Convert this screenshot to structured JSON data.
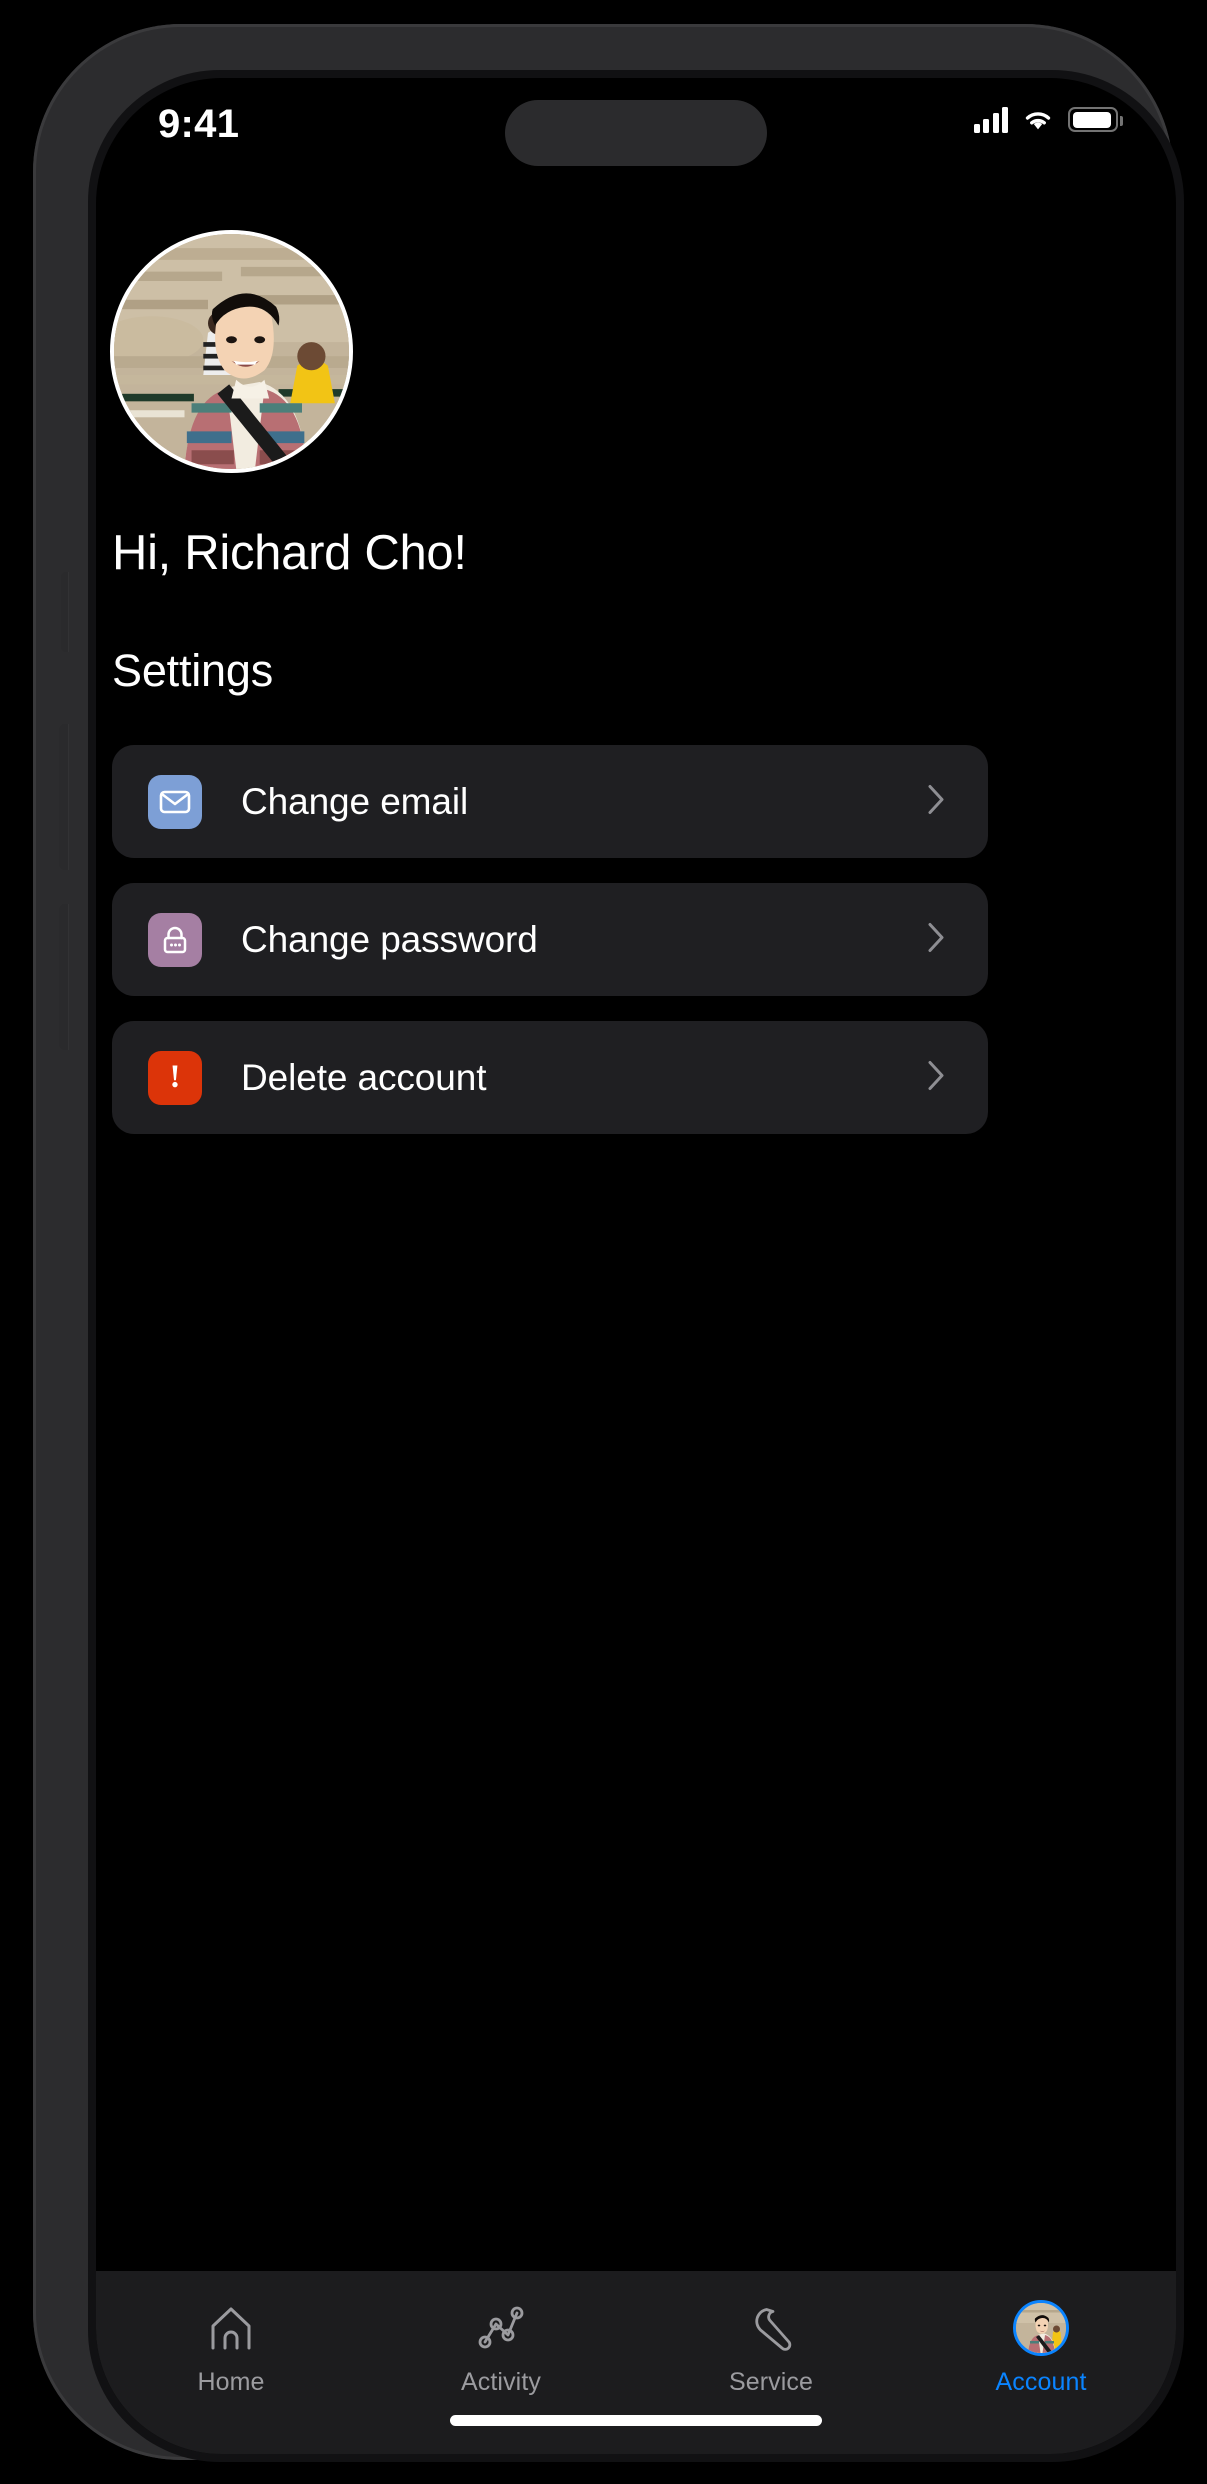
{
  "status_bar": {
    "time": "9:41",
    "cellular_icon": "cellular-signal-icon",
    "wifi_icon": "wifi-icon",
    "battery_icon": "battery-icon"
  },
  "profile": {
    "avatar_alt": "user-profile-photo",
    "greeting": "Hi, Richard Cho!"
  },
  "settings": {
    "section_title": "Settings",
    "items": [
      {
        "label": "Change email",
        "icon": "envelope-icon",
        "icon_bg": "#7d9fd6",
        "chevron": "chevron-right-icon"
      },
      {
        "label": "Change password",
        "icon": "lock-icon",
        "icon_bg": "#a57fa3",
        "chevron": "chevron-right-icon"
      },
      {
        "label": "Delete account",
        "icon": "exclamation-icon",
        "icon_bg": "#dc3409",
        "chevron": "chevron-right-icon"
      }
    ]
  },
  "tab_bar": {
    "active_color": "#0a84ff",
    "inactive_color": "#9b9b9f",
    "tabs": [
      {
        "label": "Home",
        "icon": "house-icon",
        "active": false
      },
      {
        "label": "Activity",
        "icon": "line-chart-icon",
        "active": false
      },
      {
        "label": "Service",
        "icon": "wrench-icon",
        "active": false
      },
      {
        "label": "Account",
        "icon": "avatar-icon",
        "active": true
      }
    ]
  },
  "theme": {
    "screen_bg": "#000000",
    "card_bg": "#1f1f22",
    "tabbar_bg": "#1c1c1e",
    "text_primary": "#ffffff"
  }
}
